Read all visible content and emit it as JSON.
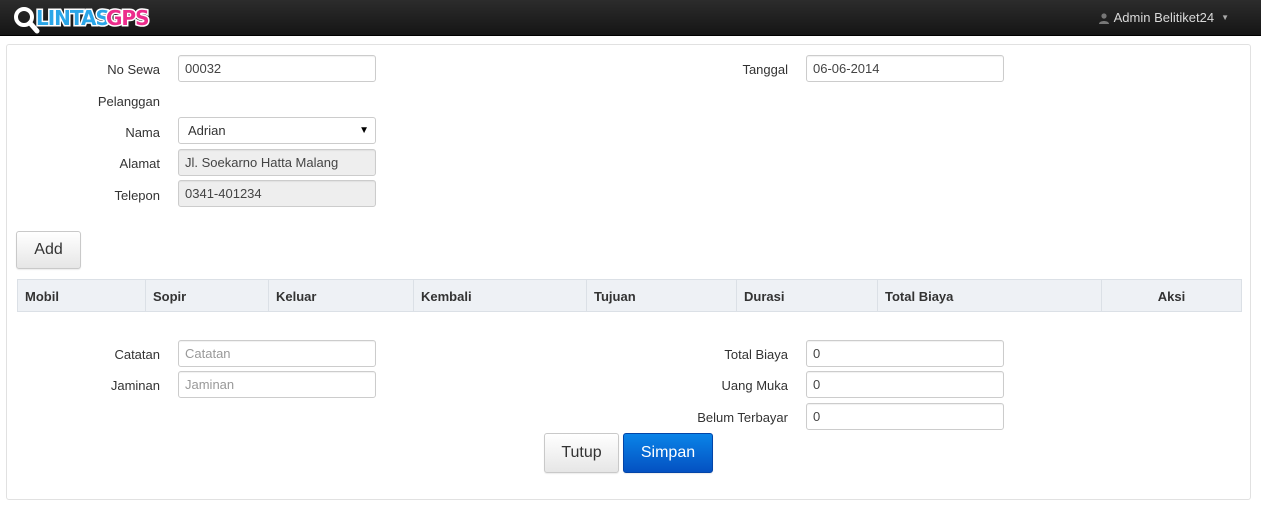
{
  "navbar": {
    "brand": "LINTASGPS",
    "user_label": "Admin Belitiket24"
  },
  "form": {
    "no_sewa_label": "No Sewa",
    "no_sewa_value": "00032",
    "tanggal_label": "Tanggal",
    "tanggal_value": "06-06-2014",
    "pelanggan_label": "Pelanggan",
    "nama_label": "Nama",
    "nama_value": "Adrian",
    "alamat_label": "Alamat",
    "alamat_value": "Jl. Soekarno Hatta Malang",
    "telepon_label": "Telepon",
    "telepon_value": "0341-401234"
  },
  "add_button": "Add",
  "table": {
    "columns": [
      "Mobil",
      "Sopir",
      "Keluar",
      "Kembali",
      "Tujuan",
      "Durasi",
      "Total Biaya",
      "Aksi"
    ]
  },
  "footer": {
    "catatan_label": "Catatan",
    "catatan_placeholder": "Catatan",
    "jaminan_label": "Jaminan",
    "jaminan_placeholder": "Jaminan",
    "total_biaya_label": "Total Biaya",
    "total_biaya_value": "0",
    "uang_muka_label": "Uang Muka",
    "uang_muka_value": "0",
    "belum_terbayar_label": "Belum Terbayar",
    "belum_terbayar_value": "0"
  },
  "buttons": {
    "tutup": "Tutup",
    "simpan": "Simpan"
  },
  "colors": {
    "primary": "#0a6fd8",
    "navbar": "#1b1b1b"
  }
}
